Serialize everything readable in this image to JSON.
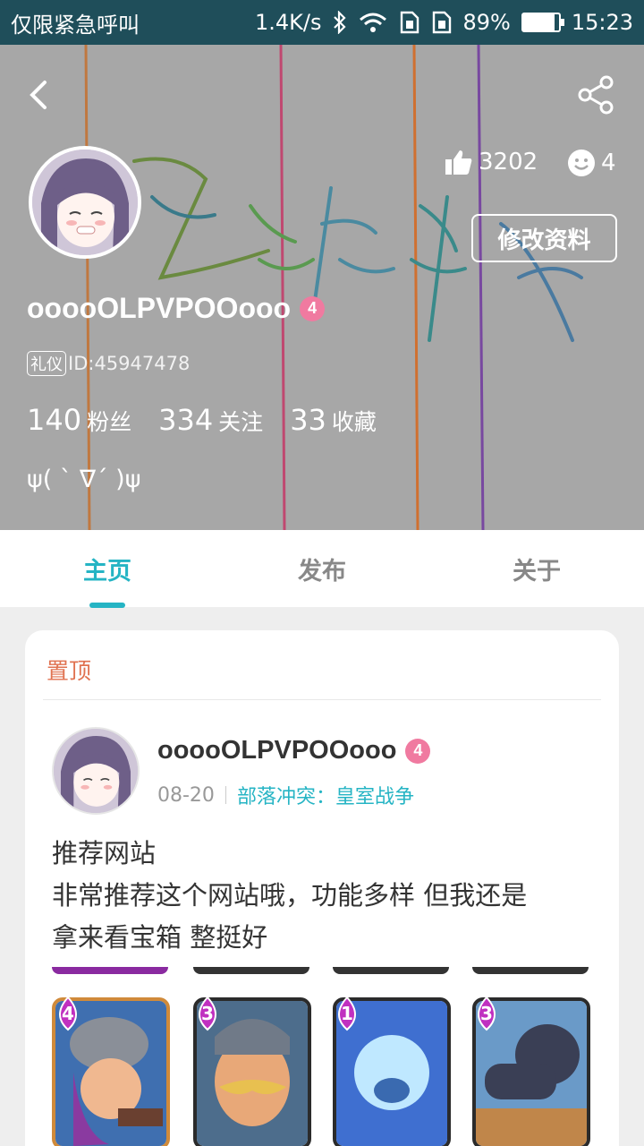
{
  "status_bar": {
    "carrier": "仅限紧急呼叫",
    "speed": "1.4K/s",
    "battery": "89%",
    "battery_level": 0.89,
    "time": "15:23"
  },
  "profile": {
    "likes": "3202",
    "faces": "4",
    "edit_button": "修改资料",
    "username": "ooooOLPVPOOooo",
    "level": "4",
    "id_tag": "礼仪",
    "id_text": "ID:45947478",
    "followers_num": "140",
    "followers_label": "粉丝",
    "following_num": "334",
    "following_label": "关注",
    "favorites_num": "33",
    "favorites_label": "收藏",
    "bio": "ψ( ` ∇´ )ψ"
  },
  "tabs": [
    {
      "label": "主页",
      "active": true
    },
    {
      "label": "发布",
      "active": false
    },
    {
      "label": "关于",
      "active": false
    }
  ],
  "post": {
    "pinned_label": "置顶",
    "username": "ooooOLPVPOOooo",
    "level": "4",
    "date": "08-20",
    "category": "部落冲突：皇室战争",
    "title": "推荐网站",
    "body_line1": "非常推荐这个网站哦，功能多样 但我还是",
    "body_line2": "拿来看宝箱 整挺好"
  },
  "game_cards": [
    {
      "elixir": "4",
      "name": "musketeer",
      "color": "#c06a3a"
    },
    {
      "elixir": "3",
      "name": "knight",
      "color": "#4d6d8c"
    },
    {
      "elixir": "1",
      "name": "ice spirit",
      "color": "#3f6fd0"
    },
    {
      "elixir": "3",
      "name": "cannon",
      "color": "#5a7fa8"
    }
  ]
}
